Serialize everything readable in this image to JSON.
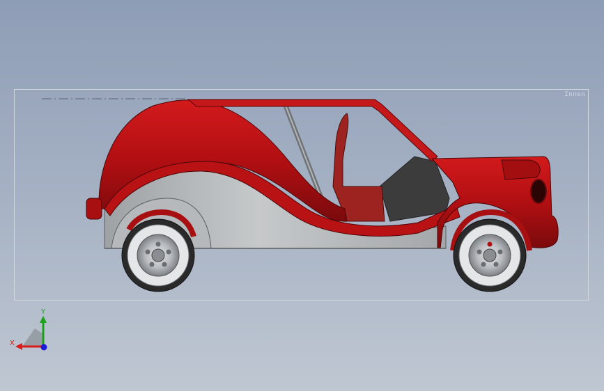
{
  "viewport": {
    "background_top": "#8e9db6",
    "background_bottom": "#bfc7d2",
    "bounding_box_label": "Innen"
  },
  "model": {
    "body_color": "#b10f12",
    "body_dark_color": "#7a0a0c",
    "panel_color": "#aeb2b4",
    "interior_color": "#3a3a3a",
    "tire_color": "#2a2a2a",
    "rim_color": "#b8bcc0"
  },
  "triad": {
    "x_label": "X",
    "y_label": "Y",
    "x_color": "#d81b1b",
    "y_color": "#1aa31a",
    "z_color": "#1b1bd8"
  }
}
